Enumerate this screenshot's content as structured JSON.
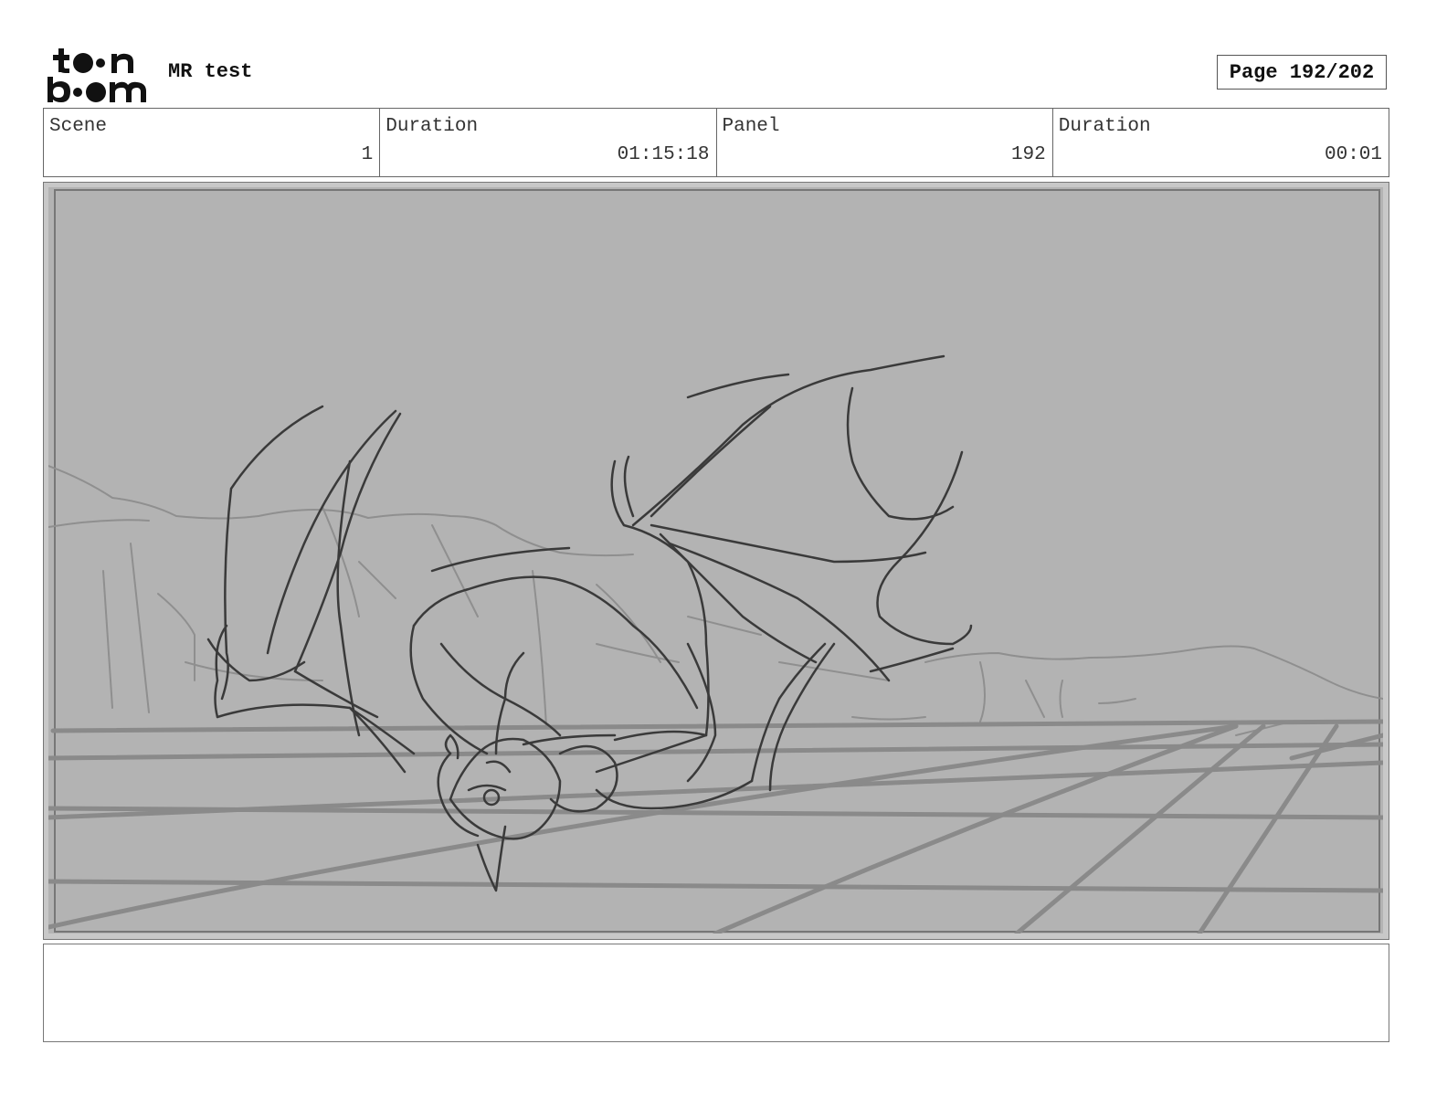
{
  "header": {
    "brand": "toon boom",
    "project_title": "MR test",
    "page_label": "Page 192/202"
  },
  "info": [
    {
      "label": "Scene",
      "value": "1"
    },
    {
      "label": "Duration",
      "value": "01:15:18"
    },
    {
      "label": "Panel",
      "value": "192"
    },
    {
      "label": "Duration",
      "value": "00:01"
    }
  ],
  "panel": {
    "icon": "storyboard-sketch",
    "colors": {
      "background": "#b3b3b3",
      "ink": "#3a3a3a",
      "grid": "#8a8a8a",
      "light_line": "#8f8f8f"
    }
  },
  "notes": {
    "text": ""
  }
}
